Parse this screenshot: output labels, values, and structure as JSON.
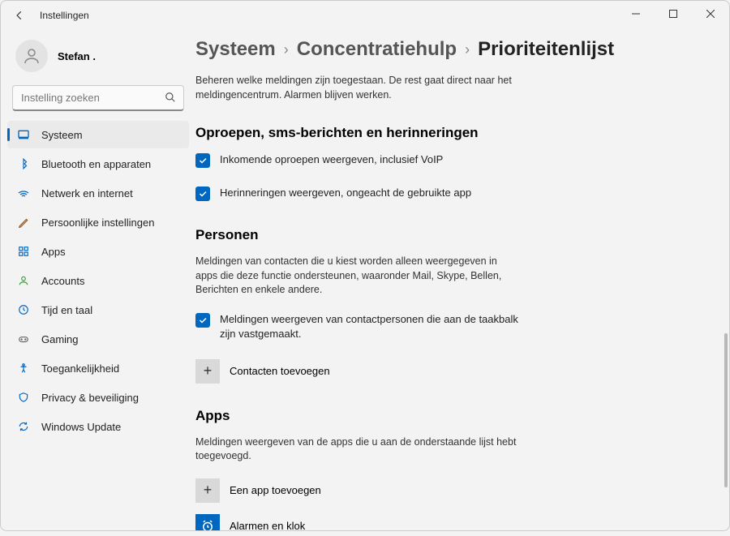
{
  "window": {
    "title": "Instellingen"
  },
  "user": {
    "name": "Stefan .",
    "sub": ""
  },
  "search": {
    "placeholder": "Instelling zoeken"
  },
  "sidebar": {
    "items": [
      {
        "label": "Systeem",
        "active": true
      },
      {
        "label": "Bluetooth en apparaten"
      },
      {
        "label": "Netwerk en internet"
      },
      {
        "label": "Persoonlijke instellingen"
      },
      {
        "label": "Apps"
      },
      {
        "label": "Accounts"
      },
      {
        "label": "Tijd en taal"
      },
      {
        "label": "Gaming"
      },
      {
        "label": "Toegankelijkheid"
      },
      {
        "label": "Privacy & beveiliging"
      },
      {
        "label": "Windows Update"
      }
    ]
  },
  "breadcrumb": {
    "a": "Systeem",
    "b": "Concentratiehulp",
    "c": "Prioriteitenlijst"
  },
  "page_desc": "Beheren welke meldingen zijn toegestaan. De rest gaat direct naar het meldingencentrum. Alarmen blijven werken.",
  "section1": {
    "title": "Oproepen, sms-berichten en herinneringen",
    "check1": "Inkomende oproepen weergeven, inclusief VoIP",
    "check2": "Herinneringen weergeven, ongeacht de gebruikte app"
  },
  "section2": {
    "title": "Personen",
    "desc": "Meldingen van contacten die u kiest worden alleen weergegeven in apps die deze functie ondersteunen, waaronder Mail, Skype, Bellen, Berichten en enkele andere.",
    "check1": "Meldingen weergeven van contactpersonen die aan de taakbalk zijn vastgemaakt.",
    "add_label": "Contacten toevoegen"
  },
  "section3": {
    "title": "Apps",
    "desc": "Meldingen weergeven van de apps die u aan de onderstaande lijst hebt toegevoegd.",
    "add_label": "Een app toevoegen",
    "app1": "Alarmen en klok"
  }
}
